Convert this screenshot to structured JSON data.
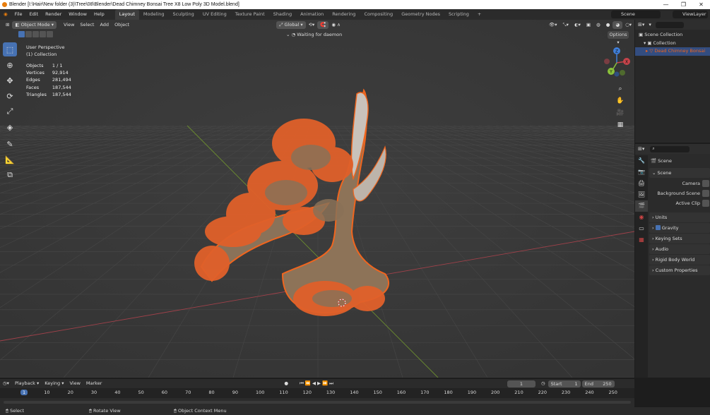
{
  "window": {
    "title": "Blender [I:\\Hair\\New folder (3)\\Tree\\08\\Blender\\Dead Chimney Bonsai Tree X8 Low Poly 3D Model.blend]",
    "controls": [
      "—",
      "❐",
      "✕"
    ]
  },
  "menubar": {
    "menus": [
      "File",
      "Edit",
      "Render",
      "Window",
      "Help"
    ],
    "workspaces": [
      "Layout",
      "Modeling",
      "Sculpting",
      "UV Editing",
      "Texture Paint",
      "Shading",
      "Animation",
      "Rendering",
      "Compositing",
      "Geometry Nodes",
      "Scripting"
    ],
    "active_workspace": "Layout",
    "add_tab": "+",
    "scene": "Scene",
    "view_layer": "ViewLayer"
  },
  "viewport": {
    "mode": "Object Mode",
    "menus": [
      "View",
      "Select",
      "Add",
      "Object"
    ],
    "transform_orientation": "Global",
    "status": "Waiting for daemon",
    "options": "Options",
    "perspective": "User Perspective",
    "collection": "(1) Collection",
    "stats": [
      {
        "label": "Objects",
        "value": "1 / 1"
      },
      {
        "label": "Vertices",
        "value": "92,914"
      },
      {
        "label": "Edges",
        "value": "281,494"
      },
      {
        "label": "Faces",
        "value": "187,544"
      },
      {
        "label": "Triangles",
        "value": "187,544"
      }
    ],
    "gizmo_axes": {
      "x": "X",
      "y": "Y",
      "z": "Z"
    },
    "colors": {
      "x_axis": "#c5434a",
      "y_axis": "#8ac13a",
      "z_axis": "#3f7ed9",
      "selection": "#f0651e",
      "active_tool": "#4772b3"
    }
  },
  "toolbar": {
    "tools": [
      "select-box-icon",
      "cursor-icon",
      "move-icon",
      "rotate-icon",
      "scale-icon",
      "transform-icon",
      "annotate-icon",
      "measure-icon",
      "add-cube-icon"
    ]
  },
  "outliner": {
    "items": [
      {
        "label": "Scene Collection"
      },
      {
        "label": "Collection"
      },
      {
        "label": "Dead Chimney Bonsai"
      }
    ]
  },
  "properties": {
    "breadcrumb": "Scene",
    "panel_title": "Scene",
    "fields": [
      {
        "label": "Camera"
      },
      {
        "label": "Background Scene"
      },
      {
        "label": "Active Clip"
      }
    ],
    "panels": [
      "Units",
      "Gravity",
      "Keying Sets",
      "Audio",
      "Rigid Body World",
      "Custom Properties"
    ]
  },
  "timeline": {
    "menus": [
      "Playback",
      "Keying",
      "View",
      "Marker"
    ],
    "current_frame": "1",
    "start_label": "Start",
    "start": "1",
    "end_label": "End",
    "end": "250",
    "ticks": [
      "1",
      "10",
      "20",
      "30",
      "40",
      "50",
      "60",
      "70",
      "80",
      "90",
      "100",
      "110",
      "120",
      "130",
      "140",
      "150",
      "160",
      "170",
      "180",
      "190",
      "200",
      "210",
      "220",
      "230",
      "240",
      "250"
    ]
  },
  "statusbar": {
    "items": [
      "Select",
      "Rotate View",
      "Object Context Menu"
    ]
  }
}
